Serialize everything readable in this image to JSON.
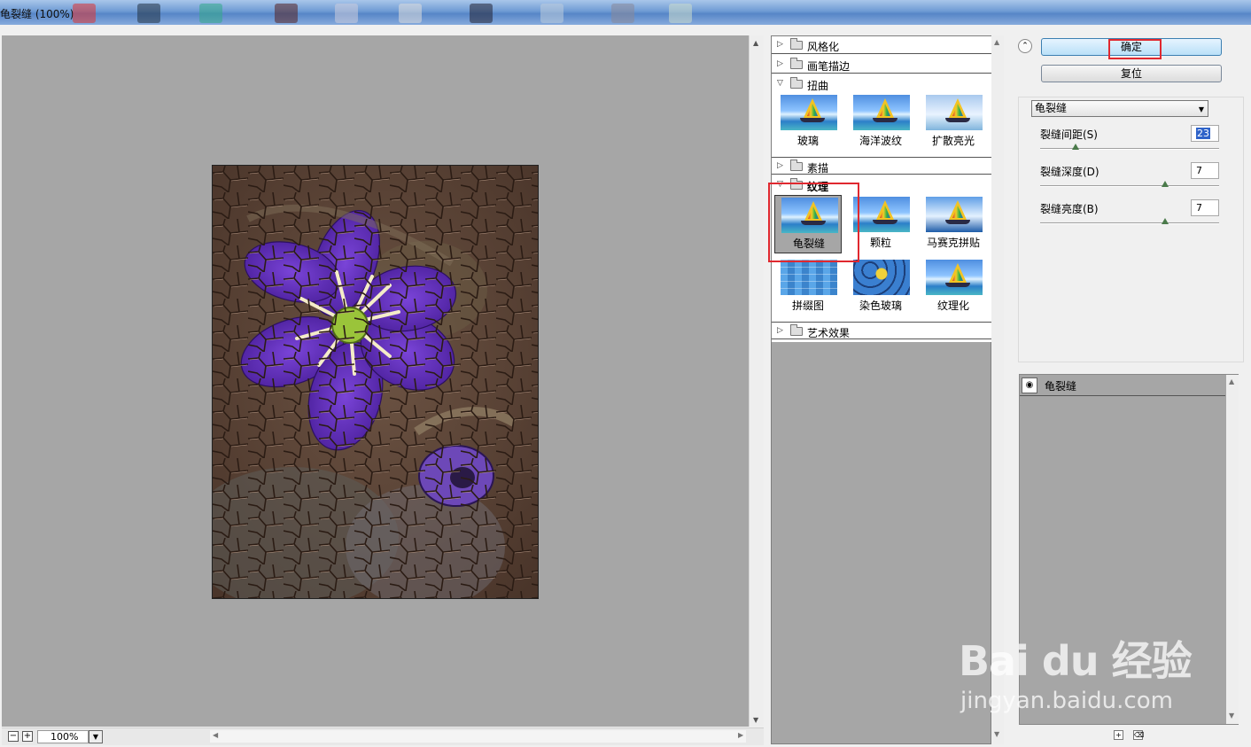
{
  "window": {
    "title": "龟裂缝 (100%)"
  },
  "preview": {
    "zoom": "100%"
  },
  "gallery": {
    "categories": [
      {
        "label": "风格化",
        "expanded": false
      },
      {
        "label": "画笔描边",
        "expanded": false
      },
      {
        "label": "扭曲",
        "expanded": true
      },
      {
        "label": "素描",
        "expanded": false
      },
      {
        "label": "纹理",
        "expanded": true
      },
      {
        "label": "艺术效果",
        "expanded": false
      }
    ],
    "distort_filters": [
      "玻璃",
      "海洋波纹",
      "扩散亮光"
    ],
    "texture_filters": [
      "龟裂缝",
      "颗粒",
      "马赛克拼贴",
      "拼缀图",
      "染色玻璃",
      "纹理化"
    ],
    "selected_filter": "龟裂缝"
  },
  "buttons": {
    "ok": "确定",
    "reset": "复位"
  },
  "settings": {
    "filter_select": "龟裂缝",
    "params": [
      {
        "label": "裂缝间距(S)",
        "value": "23",
        "slider_fraction": 0.2
      },
      {
        "label": "裂缝深度(D)",
        "value": "7",
        "slider_fraction": 0.7
      },
      {
        "label": "裂缝亮度(B)",
        "value": "7",
        "slider_fraction": 0.7
      }
    ]
  },
  "layers": {
    "items": [
      {
        "name": "龟裂缝"
      }
    ]
  },
  "watermark": {
    "brand": "Bai du 经验",
    "url": "jingyan.baidu.com"
  }
}
